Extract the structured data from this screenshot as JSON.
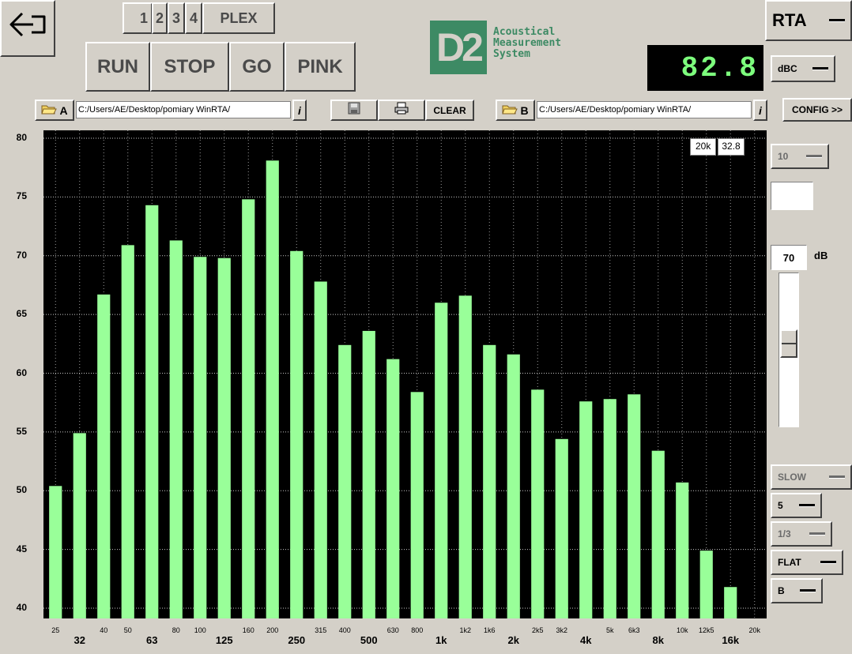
{
  "toolbar": {
    "back_label": "⇦",
    "tabs": [
      "1",
      "2",
      "3",
      "4",
      "PLEX"
    ],
    "run": "RUN",
    "stop": "STOP",
    "go": "GO",
    "pink": "PINK"
  },
  "logo": {
    "mark": "D2",
    "line1": "Acoustical",
    "line2": "Measurement",
    "line3": "System"
  },
  "mode": {
    "label": "RTA"
  },
  "readout": {
    "value": "82.8",
    "weighting": "dBC"
  },
  "fileA": {
    "label": "A",
    "path": "C:/Users/AE/Desktop/pomiary WinRTA/",
    "info": "i"
  },
  "fileB": {
    "label": "B",
    "path": "C:/Users/AE/Desktop/pomiary WinRTA/",
    "info": "i"
  },
  "mid_buttons": {
    "clear": "CLEAR"
  },
  "config": {
    "label": "CONFIG >>"
  },
  "cursor": {
    "freq": "20k",
    "level": "32.8"
  },
  "right_panel": {
    "range": "10",
    "ref_value": "70",
    "ref_unit": "dB",
    "slider_level": 0.55,
    "speed": "SLOW",
    "avg": "5",
    "bands": "1/3",
    "weight": "FLAT",
    "channel": "B"
  },
  "icons": {
    "back": "back-arrow-icon",
    "open_a": "folder-open-icon",
    "open_b": "folder-open-icon",
    "save": "save-icon",
    "print": "printer-icon"
  },
  "colors": {
    "bar": "#99ff99",
    "plot_bg": "#000000",
    "readout": "#7dff7d",
    "logo": "#3d8a64"
  },
  "chart_data": {
    "type": "bar",
    "yticks": [
      "80",
      "75",
      "70",
      "65",
      "60",
      "55",
      "50",
      "45",
      "40"
    ],
    "ylim": [
      40,
      80
    ],
    "grid": true,
    "categories": [
      "25",
      "32",
      "40",
      "50",
      "63",
      "80",
      "100",
      "125",
      "160",
      "200",
      "250",
      "315",
      "400",
      "500",
      "630",
      "800",
      "1k",
      "1k2",
      "1k6",
      "2k",
      "2k5",
      "3k2",
      "4k",
      "5k",
      "6k3",
      "8k",
      "10k",
      "12k5",
      "16k",
      "20k"
    ],
    "major": [
      "32",
      "63",
      "125",
      "250",
      "500",
      "1k",
      "2k",
      "4k",
      "8k",
      "16k"
    ],
    "values": [
      50.4,
      54.9,
      66.7,
      70.9,
      74.3,
      71.3,
      69.9,
      69.8,
      74.8,
      78.1,
      70.4,
      67.8,
      62.4,
      63.6,
      61.2,
      58.4,
      66.0,
      66.6,
      62.4,
      61.6,
      58.6,
      54.4,
      57.6,
      57.8,
      58.2,
      53.4,
      50.7,
      44.9,
      41.8,
      null
    ]
  }
}
